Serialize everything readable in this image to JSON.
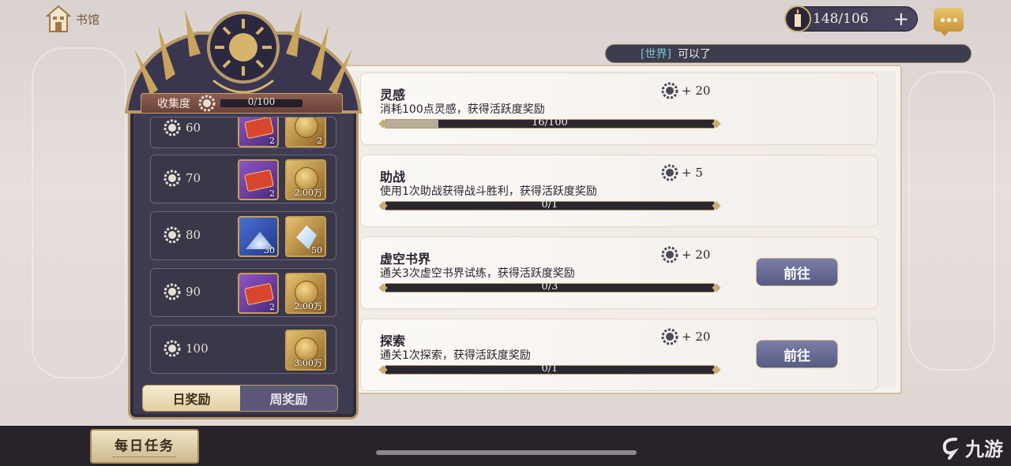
{
  "nav": {
    "home_label": "书馆"
  },
  "currency": {
    "value": "148/106",
    "plus": "+"
  },
  "world_chat": {
    "tag": "[世界]",
    "message": "可以了"
  },
  "collection": {
    "label": "收集度",
    "value": "0/100"
  },
  "reward_tiers": [
    {
      "tier": "60",
      "items": [
        {
          "type": "purple",
          "count": "2"
        },
        {
          "type": "gold",
          "count": "2"
        }
      ]
    },
    {
      "tier": "70",
      "items": [
        {
          "type": "purple",
          "count": "2"
        },
        {
          "type": "gold",
          "count": "2.00万"
        }
      ]
    },
    {
      "tier": "80",
      "items": [
        {
          "type": "blue",
          "count": "30"
        },
        {
          "type": "gold",
          "count": "50"
        }
      ]
    },
    {
      "tier": "90",
      "items": [
        {
          "type": "purple",
          "count": "2"
        },
        {
          "type": "gold",
          "count": "2.00万"
        }
      ]
    },
    {
      "tier": "100",
      "items": [
        {
          "type": "gold",
          "count": "3.00万"
        }
      ]
    }
  ],
  "tabs": {
    "daily": "日奖励",
    "weekly": "周奖励",
    "active": "daily"
  },
  "tasks": [
    {
      "title": "灵感",
      "desc": "消耗100点灵感，获得活跃度奖励",
      "reward": "+ 20",
      "progress": "16/100",
      "fraction": 0.16,
      "button": ""
    },
    {
      "title": "助战",
      "desc": "使用1次助战获得战斗胜利，获得活跃度奖励",
      "reward": "+ 5",
      "progress": "0/1",
      "fraction": 0,
      "button": ""
    },
    {
      "title": "虚空书界",
      "desc": "通关3次虚空书界试练，获得活跃度奖励",
      "reward": "+ 20",
      "progress": "0/3",
      "fraction": 0,
      "button": "前往"
    },
    {
      "title": "探索",
      "desc": "通关1次探索，获得活跃度奖励",
      "reward": "+ 20",
      "progress": "0/1",
      "fraction": 0,
      "button": "前往"
    }
  ],
  "bottom": {
    "daily_tasks": "每日任务"
  },
  "watermark": {
    "text": "九游"
  },
  "colors": {
    "accent": "#c9ad74",
    "panel": "#3f3c52",
    "button": "#575a82"
  }
}
